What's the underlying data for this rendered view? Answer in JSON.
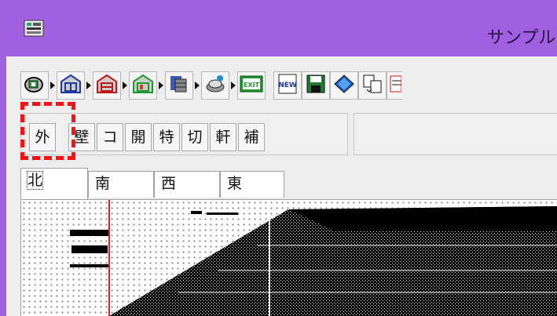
{
  "window": {
    "title": "サンプル"
  },
  "toolbar_main": {
    "tools": [
      {
        "icon": "site-plan-icon"
      },
      {
        "icon": "floor-plan-blue-icon"
      },
      {
        "icon": "floor-plan-red-icon"
      },
      {
        "icon": "floor-plan-green-icon"
      },
      {
        "icon": "stairs-icon"
      },
      {
        "icon": "render-icon"
      },
      {
        "icon": "exit-icon",
        "label": "EXIT"
      }
    ],
    "file_tools": [
      {
        "icon": "new-icon",
        "label": "NEW"
      },
      {
        "icon": "save-icon"
      },
      {
        "icon": "book-icon"
      },
      {
        "icon": "copy-icon"
      }
    ]
  },
  "toolbar_parts": {
    "buttons": [
      "外",
      "壁",
      "コ",
      "開",
      "特",
      "切",
      "軒",
      "補"
    ]
  },
  "tabs": [
    "北",
    "南",
    "西",
    "東"
  ],
  "colors": {
    "titlebar": "#a060e0",
    "highlight": "#ff1010",
    "guide_line": "#e02020"
  }
}
